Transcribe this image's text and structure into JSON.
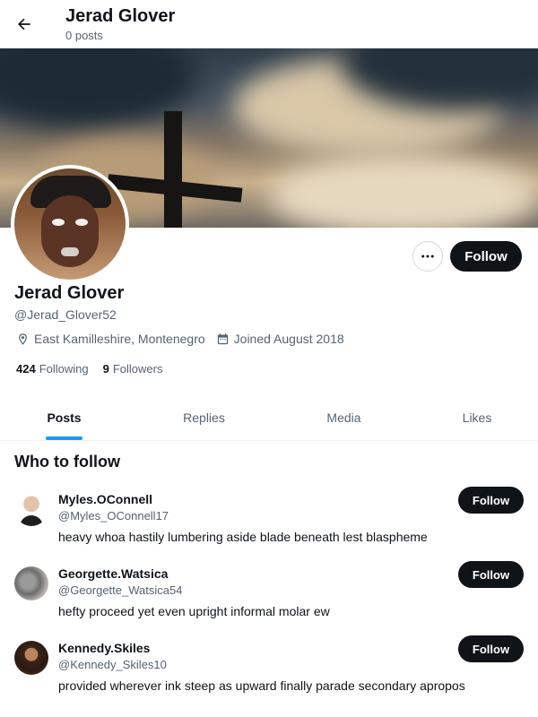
{
  "header": {
    "title": "Jerad Glover",
    "subtitle": "0 posts"
  },
  "profile": {
    "name": "Jerad Glover",
    "handle": "@Jerad_Glover52",
    "location": "East Kamilleshire, Montenegro",
    "joined": "Joined August 2018",
    "following_count": "424",
    "following_label": "Following",
    "followers_count": "9",
    "followers_label": "Followers",
    "follow_label": "Follow",
    "more_icon": "more-horizontal-icon"
  },
  "tabs": [
    {
      "label": "Posts",
      "active": true
    },
    {
      "label": "Replies",
      "active": false
    },
    {
      "label": "Media",
      "active": false
    },
    {
      "label": "Likes",
      "active": false
    }
  ],
  "who_to_follow": {
    "title": "Who to follow",
    "items": [
      {
        "name": "Myles.OConnell",
        "handle": "@Myles_OConnell17",
        "bio": "heavy whoa hastily lumbering aside blade beneath lest blaspheme",
        "follow_label": "Follow"
      },
      {
        "name": "Georgette.Watsica",
        "handle": "@Georgette_Watsica54",
        "bio": "hefty proceed yet even upright informal molar ew",
        "follow_label": "Follow"
      },
      {
        "name": "Kennedy.Skiles",
        "handle": "@Kennedy_Skiles10",
        "bio": "provided wherever ink steep as upward finally parade secondary apropos",
        "follow_label": "Follow"
      }
    ]
  },
  "colors": {
    "accent": "#1d9bf0",
    "text_primary": "#0f1419",
    "text_secondary": "#536471",
    "button_dark": "#0f1419"
  }
}
